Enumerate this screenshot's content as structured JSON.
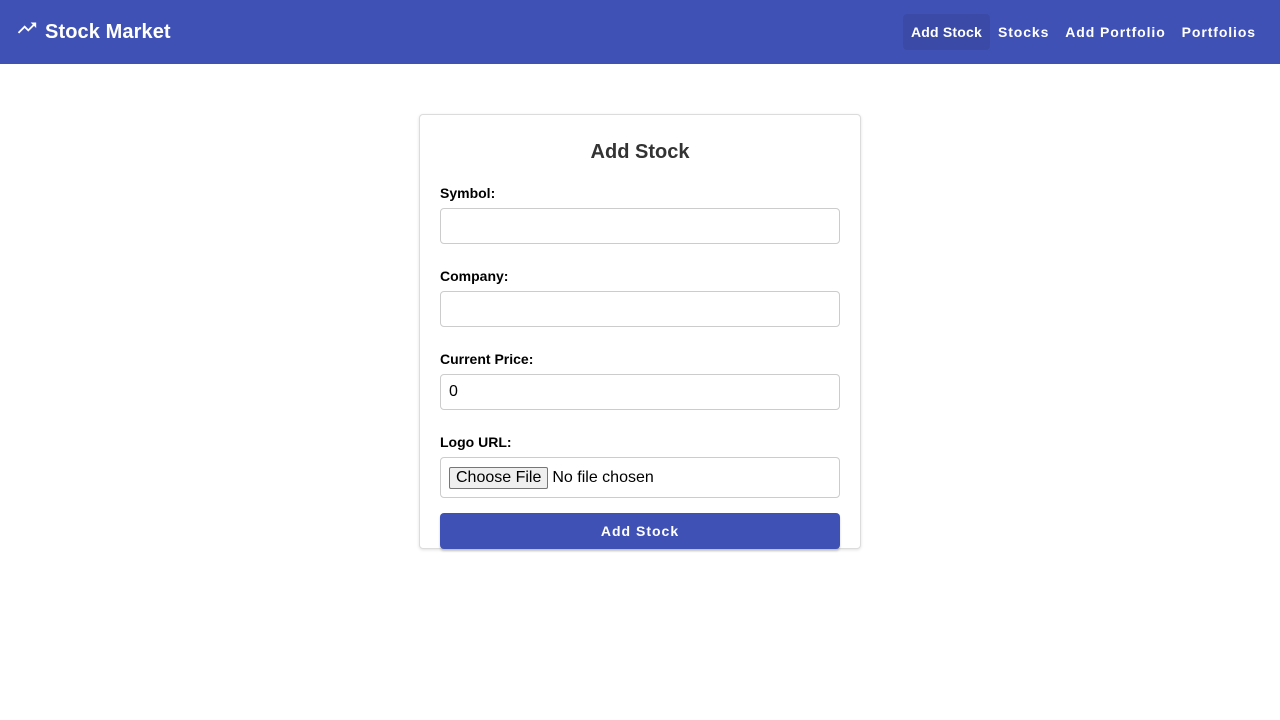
{
  "colors": {
    "primary": "#3f51b5",
    "background": "#ffffff",
    "card_border": "#dcdcdc"
  },
  "header": {
    "brand_icon": "trending-up-icon",
    "title": "Stock Market",
    "nav": [
      {
        "label": "Add Stock",
        "active": true
      },
      {
        "label": "Stocks",
        "active": false
      },
      {
        "label": "Add Portfolio",
        "active": false
      },
      {
        "label": "Portfolios",
        "active": false
      }
    ]
  },
  "form": {
    "title": "Add Stock",
    "symbol": {
      "label": "Symbol:",
      "value": ""
    },
    "company": {
      "label": "Company:",
      "value": ""
    },
    "current_price": {
      "label": "Current Price:",
      "value": "0"
    },
    "logo": {
      "label": "Logo URL:",
      "button_label": "Choose File",
      "status": "No file chosen"
    },
    "submit_label": "Add Stock"
  }
}
